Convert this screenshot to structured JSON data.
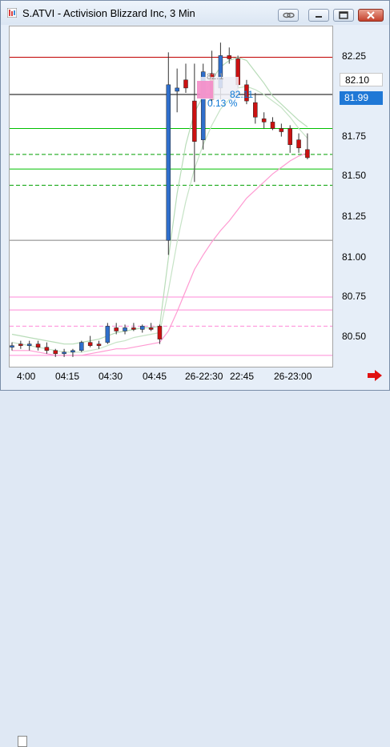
{
  "window": {
    "title": "S.ATVI - Activision Blizzard Inc, 3 Min"
  },
  "title_buttons": [
    "link-icon",
    "minimize-icon",
    "restore-icon",
    "close-icon"
  ],
  "colors": {
    "up": "#2f6fcc",
    "down": "#cc1111",
    "accent_blue": "#0b77d6"
  },
  "y_axis": {
    "ticks": [
      "82.25",
      "81.75",
      "81.50",
      "81.25",
      "81.00",
      "80.75",
      "80.50"
    ],
    "current_price_tag": "82.10",
    "last_price_tag": "81.99"
  },
  "x_axis": {
    "ticks": [
      "4:00",
      "04:15",
      "04:30",
      "04:45",
      "26-22:30",
      "22:45",
      "26-23:00"
    ]
  },
  "overlay": {
    "label_top": "82.11",
    "label_bottom": "0.13 %"
  },
  "chart_data": {
    "type": "candlestick",
    "symbol": "S.ATVI",
    "interval": "3 Min",
    "ylim": [
      80.33,
      82.43
    ],
    "candles": [
      {
        "o": 80.45,
        "h": 80.48,
        "l": 80.43,
        "c": 80.46,
        "dir": "up"
      },
      {
        "o": 80.47,
        "h": 80.49,
        "l": 80.44,
        "c": 80.46,
        "dir": "down"
      },
      {
        "o": 80.46,
        "h": 80.49,
        "l": 80.43,
        "c": 80.47,
        "dir": "up"
      },
      {
        "o": 80.47,
        "h": 80.49,
        "l": 80.43,
        "c": 80.45,
        "dir": "down"
      },
      {
        "o": 80.45,
        "h": 80.48,
        "l": 80.41,
        "c": 80.43,
        "dir": "down"
      },
      {
        "o": 80.43,
        "h": 80.44,
        "l": 80.39,
        "c": 80.41,
        "dir": "down"
      },
      {
        "o": 80.41,
        "h": 80.44,
        "l": 80.39,
        "c": 80.42,
        "dir": "up"
      },
      {
        "o": 80.42,
        "h": 80.44,
        "l": 80.39,
        "c": 80.43,
        "dir": "up"
      },
      {
        "o": 80.43,
        "h": 80.49,
        "l": 80.42,
        "c": 80.48,
        "dir": "up"
      },
      {
        "o": 80.48,
        "h": 80.52,
        "l": 80.45,
        "c": 80.46,
        "dir": "down"
      },
      {
        "o": 80.46,
        "h": 80.49,
        "l": 80.44,
        "c": 80.47,
        "dir": "down"
      },
      {
        "o": 80.48,
        "h": 80.6,
        "l": 80.47,
        "c": 80.58,
        "dir": "up"
      },
      {
        "o": 80.57,
        "h": 80.6,
        "l": 80.53,
        "c": 80.55,
        "dir": "down"
      },
      {
        "o": 80.55,
        "h": 80.59,
        "l": 80.53,
        "c": 80.57,
        "dir": "up"
      },
      {
        "o": 80.57,
        "h": 80.6,
        "l": 80.55,
        "c": 80.56,
        "dir": "down"
      },
      {
        "o": 80.56,
        "h": 80.59,
        "l": 80.54,
        "c": 80.58,
        "dir": "up"
      },
      {
        "o": 80.57,
        "h": 80.6,
        "l": 80.55,
        "c": 80.56,
        "dir": "down"
      },
      {
        "o": 80.58,
        "h": 80.59,
        "l": 80.47,
        "c": 80.5,
        "dir": "down"
      },
      {
        "o": 81.11,
        "h": 82.27,
        "l": 81.02,
        "c": 82.07,
        "dir": "up"
      },
      {
        "o": 82.05,
        "h": 82.17,
        "l": 81.9,
        "c": 82.03,
        "dir": "up"
      },
      {
        "o": 82.1,
        "h": 82.2,
        "l": 82.02,
        "c": 82.05,
        "dir": "down"
      },
      {
        "o": 81.97,
        "h": 82.2,
        "l": 81.47,
        "c": 81.72,
        "dir": "down"
      },
      {
        "o": 81.73,
        "h": 82.2,
        "l": 81.67,
        "c": 82.15,
        "dir": "up"
      },
      {
        "o": 82.14,
        "h": 82.28,
        "l": 81.95,
        "c": 81.98,
        "dir": "down"
      },
      {
        "o": 82.05,
        "h": 82.33,
        "l": 81.98,
        "c": 82.25,
        "dir": "up"
      },
      {
        "o": 82.25,
        "h": 82.3,
        "l": 82.2,
        "c": 82.23,
        "dir": "down"
      },
      {
        "o": 82.23,
        "h": 82.25,
        "l": 82.05,
        "c": 82.07,
        "dir": "down"
      },
      {
        "o": 82.07,
        "h": 82.1,
        "l": 81.95,
        "c": 81.97,
        "dir": "down"
      },
      {
        "o": 81.96,
        "h": 82.02,
        "l": 81.83,
        "c": 81.87,
        "dir": "down"
      },
      {
        "o": 81.86,
        "h": 81.9,
        "l": 81.8,
        "c": 81.84,
        "dir": "down"
      },
      {
        "o": 81.84,
        "h": 81.87,
        "l": 81.79,
        "c": 81.8,
        "dir": "down"
      },
      {
        "o": 81.8,
        "h": 81.83,
        "l": 81.75,
        "c": 81.78,
        "dir": "down"
      },
      {
        "o": 81.8,
        "h": 81.82,
        "l": 81.65,
        "c": 81.7,
        "dir": "down"
      },
      {
        "o": 81.73,
        "h": 81.77,
        "l": 81.65,
        "c": 81.68,
        "dir": "down"
      },
      {
        "o": 81.67,
        "h": 81.77,
        "l": 81.61,
        "c": 81.62,
        "dir": "down"
      }
    ],
    "levels": [
      {
        "y": 82.24,
        "color": "#c00000",
        "style": "solid"
      },
      {
        "y": 82.01,
        "color": "#000000",
        "style": "solid"
      },
      {
        "y": 81.8,
        "color": "#00c000",
        "style": "solid"
      },
      {
        "y": 81.64,
        "color": "#00a000",
        "style": "dash"
      },
      {
        "y": 81.55,
        "color": "#00c000",
        "style": "solid"
      },
      {
        "y": 81.45,
        "color": "#00a000",
        "style": "dash"
      },
      {
        "y": 81.11,
        "color": "#808080",
        "style": "solid"
      },
      {
        "y": 80.76,
        "color": "#ff8ad8",
        "style": "solid"
      },
      {
        "y": 80.68,
        "color": "#ff8ad8",
        "style": "solid"
      },
      {
        "y": 80.58,
        "color": "#ff8ad8",
        "style": "dash"
      },
      {
        "y": 80.4,
        "color": "#ff8ad8",
        "style": "solid"
      }
    ],
    "bands": {
      "upper": [
        80.53,
        80.52,
        80.51,
        80.5,
        80.49,
        80.48,
        80.47,
        80.47,
        80.48,
        80.49,
        80.5,
        80.52,
        80.54,
        80.55,
        80.56,
        80.57,
        80.57,
        80.58,
        81.0,
        81.4,
        81.7,
        81.9,
        82.0,
        82.1,
        82.18,
        82.22,
        82.24,
        82.22,
        82.15,
        82.08,
        82.0,
        81.95,
        81.9,
        81.85,
        81.81
      ],
      "middle": [
        80.48,
        80.47,
        80.46,
        80.45,
        80.44,
        80.43,
        80.42,
        80.42,
        80.42,
        80.43,
        80.44,
        80.46,
        80.48,
        80.49,
        80.51,
        80.52,
        80.53,
        80.54,
        80.8,
        81.1,
        81.35,
        81.55,
        81.7,
        81.82,
        81.92,
        81.98,
        82.05,
        82.06,
        82.04,
        82.01,
        81.97,
        81.93,
        81.87,
        81.8,
        81.74
      ],
      "lower": [
        80.43,
        80.43,
        80.43,
        80.42,
        80.41,
        80.4,
        80.4,
        80.4,
        80.4,
        80.41,
        80.42,
        80.43,
        80.44,
        80.44,
        80.45,
        80.46,
        80.47,
        80.48,
        80.55,
        80.67,
        80.8,
        80.93,
        81.02,
        81.1,
        81.17,
        81.23,
        81.3,
        81.37,
        81.42,
        81.47,
        81.52,
        81.56,
        81.6,
        81.63,
        81.65
      ]
    }
  }
}
